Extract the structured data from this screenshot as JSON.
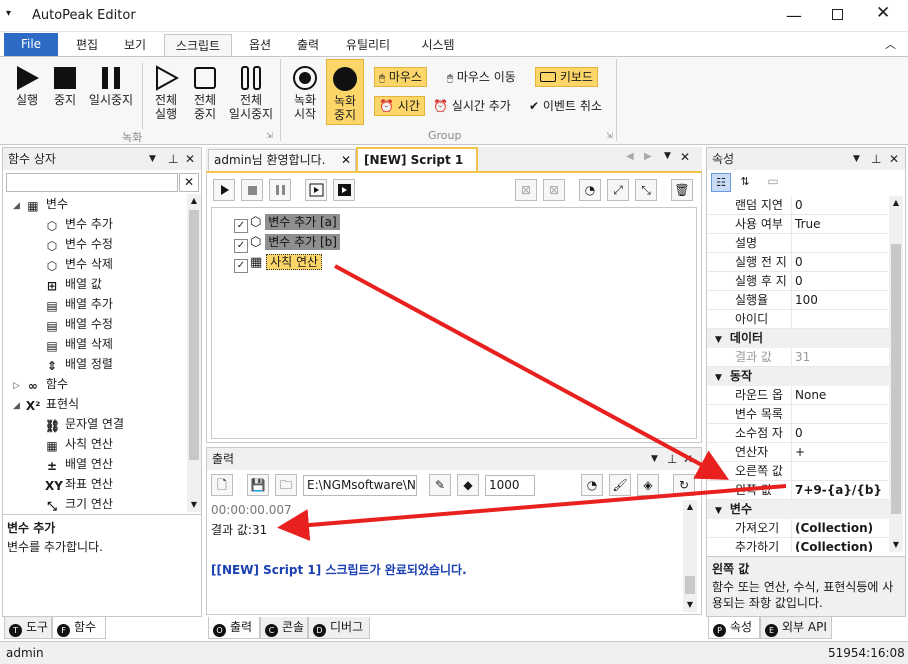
{
  "app": {
    "title": "AutoPeak Editor"
  },
  "ribbon_tabs": [
    "File",
    "편집",
    "보기",
    "스크립트",
    "옵션",
    "출력",
    "유틸리티",
    "시스템"
  ],
  "ribbon": {
    "run": "실행",
    "stop": "중지",
    "pause": "일시중지",
    "run_all": [
      "전체",
      "실행"
    ],
    "stop_all": [
      "전체",
      "중지"
    ],
    "pause_all": [
      "전체",
      "일시중지"
    ],
    "rec_start": [
      "녹화",
      "시작"
    ],
    "rec_stop": [
      "녹화",
      "중지"
    ],
    "mouse": "마우스",
    "mouse_move": "마우스 이동",
    "keyboard": "키보드",
    "time": "시간",
    "realtime_add": "실시간 추가",
    "event_cancel": "이벤트 취소",
    "group_record": "녹화",
    "group_group": "Group"
  },
  "left_panel": {
    "title": "함수 상자",
    "search_placeholder": "",
    "tree": [
      {
        "label": "변수",
        "level": 0,
        "icon": "variable-group-icon"
      },
      {
        "label": "변수 추가",
        "level": 1,
        "icon": "cube-add-icon"
      },
      {
        "label": "변수 수정",
        "level": 1,
        "icon": "cube-edit-icon"
      },
      {
        "label": "변수 삭제",
        "level": 1,
        "icon": "cube-delete-icon"
      },
      {
        "label": "배열 값",
        "level": 1,
        "icon": "array-value-icon"
      },
      {
        "label": "배열 추가",
        "level": 1,
        "icon": "array-add-icon"
      },
      {
        "label": "배열 수정",
        "level": 1,
        "icon": "array-edit-icon"
      },
      {
        "label": "배열 삭제",
        "level": 1,
        "icon": "array-delete-icon"
      },
      {
        "label": "배열 정렬",
        "level": 1,
        "icon": "sort-icon"
      },
      {
        "label": "함수",
        "level": 0,
        "icon": "infinity-icon"
      },
      {
        "label": "표현식",
        "level": 0,
        "icon": "x-squared-icon"
      },
      {
        "label": "문자열 연결",
        "level": 1,
        "icon": "link-icon"
      },
      {
        "label": "사칙 연산",
        "level": 1,
        "icon": "calculator-icon"
      },
      {
        "label": "배열 연산",
        "level": 1,
        "icon": "plus-minus-icon"
      },
      {
        "label": "좌표 연산",
        "level": 1,
        "icon": "xy-icon"
      },
      {
        "label": "크기 연산",
        "level": 1,
        "icon": "resize-icon"
      }
    ],
    "desc_title": "변수 추가",
    "desc_text": "변수를 추가합니다.",
    "tabs": [
      {
        "letter": "T",
        "label": "도구"
      },
      {
        "letter": "F",
        "label": "함수"
      }
    ]
  },
  "editor": {
    "tabs": [
      "admin님 환영합니다.",
      "[NEW] Script 1"
    ],
    "items": [
      {
        "label": "변수 추가 [a]",
        "checked": true
      },
      {
        "label": "변수 추가 [b]",
        "checked": true
      },
      {
        "label": "사칙 연산",
        "checked": true
      }
    ]
  },
  "output": {
    "title": "출력",
    "path": "E:\\NGMsoftware\\NG",
    "count": "1000",
    "lines": [
      "00:00:00.007",
      "결과 값:31",
      "",
      "[[NEW] Script 1] 스크립트가 완료되었습니다."
    ],
    "tabs": [
      {
        "letter": "O",
        "label": "출력"
      },
      {
        "letter": "C",
        "label": "콘솔"
      },
      {
        "letter": "D",
        "label": "디버그"
      }
    ]
  },
  "properties": {
    "title": "속성",
    "rows": [
      {
        "k": "랜덤 지연",
        "v": "0"
      },
      {
        "k": "사용 여부",
        "v": "True"
      },
      {
        "k": "설명",
        "v": ""
      },
      {
        "k": "실행 전 지",
        "v": "0"
      },
      {
        "k": "실행 후 지",
        "v": "0"
      },
      {
        "k": "실행율",
        "v": "100"
      },
      {
        "k": "아이디",
        "v": ""
      },
      {
        "cat": "데이터"
      },
      {
        "k": "결과 값",
        "v": "31",
        "dim": true
      },
      {
        "cat": "동작"
      },
      {
        "k": "라운드 옵",
        "v": "None"
      },
      {
        "k": "변수 목록",
        "v": ""
      },
      {
        "k": "소수점 자",
        "v": "0"
      },
      {
        "k": "연산자",
        "v": "+"
      },
      {
        "k": "오른쪽 값",
        "v": ""
      },
      {
        "k": "왼쪽 값",
        "v": "7+9-{a}/{b}",
        "bold": true
      },
      {
        "cat": "변수"
      },
      {
        "k": "가져오기",
        "v": "(Collection)",
        "bold": true
      },
      {
        "k": "추가하기",
        "v": "(Collection)",
        "bold": true
      }
    ],
    "desc_title": "왼쪽 값",
    "desc_text": "함수 또는 연산, 수식, 표현식등에 사용되는 좌항 값입니다.",
    "tabs": [
      {
        "letter": "P",
        "label": "속성"
      },
      {
        "letter": "E",
        "label": "외부 API"
      }
    ]
  },
  "status": {
    "user": "admin",
    "clock": "51954:16:08"
  },
  "colors": {
    "file_tab": "#2e6bc6",
    "highlight": "#fdd66a",
    "arrow": "#e8201e",
    "link_text": "#1a3fb0"
  }
}
